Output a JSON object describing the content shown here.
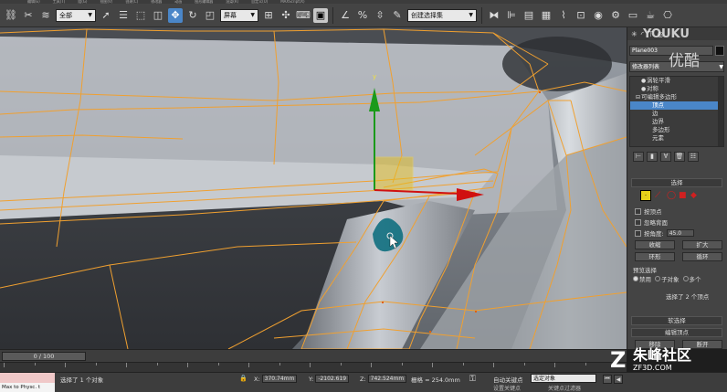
{
  "menu": [
    "编辑(E)",
    "工具(T)",
    "组(G)",
    "视图(V)",
    "创建(C)",
    "修改器",
    "动画",
    "图形编辑器",
    "渲染(R)",
    "自定义(U)",
    "MAXScript(X)"
  ],
  "toolbar": {
    "filter_dropdown": "全部",
    "refcoord_dropdown": "屏幕",
    "named_selection": "创建选择集",
    "undo_icon": "undo-icon",
    "redo_icon": "redo-icon"
  },
  "viewport": {
    "gizmo_label_y": "y",
    "mesh_color": "#f0a030",
    "gizmo_y_color": "#1a9a1a",
    "gizmo_x_color": "#d01010",
    "plane_color": "#e6c020"
  },
  "command_panel": {
    "object_name": "Plane003",
    "modifier_list": "修改器列表",
    "stack": [
      {
        "label": "涡轮平滑",
        "indent": 1
      },
      {
        "label": "对称",
        "indent": 1
      },
      {
        "label": "可编辑多边形",
        "indent": 0
      },
      {
        "label": "顶点",
        "indent": 2,
        "selected": true
      },
      {
        "label": "边",
        "indent": 2
      },
      {
        "label": "边界",
        "indent": 2
      },
      {
        "label": "多边形",
        "indent": 2
      },
      {
        "label": "元素",
        "indent": 2
      }
    ],
    "selection_title": "选择",
    "by_vertex": "按顶点",
    "ignore_backfacing": "忽略背面",
    "by_angle": "按角度:",
    "by_angle_value": "45.0",
    "shrink": "收缩",
    "grow": "扩大",
    "ring": "环形",
    "loop": "循环",
    "preview_selection": "预览选择",
    "preview_off": "禁用",
    "preview_subobject": "子对象",
    "preview_multi": "多个",
    "selected_count": "选择了 2 个顶点",
    "soft_selection": "软选择",
    "edit_vertices": "编辑顶点",
    "remove": "移除",
    "break": "断开"
  },
  "timeline": {
    "frame": "0 / 100"
  },
  "status": {
    "selection_text": "选择了 1 个对象",
    "x_label": "X:",
    "x_value": "370.74mm",
    "y_label": "Y:",
    "y_value": "-2102.619",
    "z_label": "Z:",
    "z_value": "742.524mm",
    "grid": "栅格 = 254.0mm",
    "auto_key": "自动关键点",
    "selected_set": "选定对象",
    "set_key": "设置关键点",
    "key_filters": "关键点过滤器",
    "maxscript": "Max to Physc. t"
  },
  "watermarks": {
    "youku_en": "YOUKU",
    "youku_cn": "优酷",
    "zf_logo": "Z",
    "zf_name": "朱峰社区",
    "zf_url": "ZF3D.COM"
  }
}
